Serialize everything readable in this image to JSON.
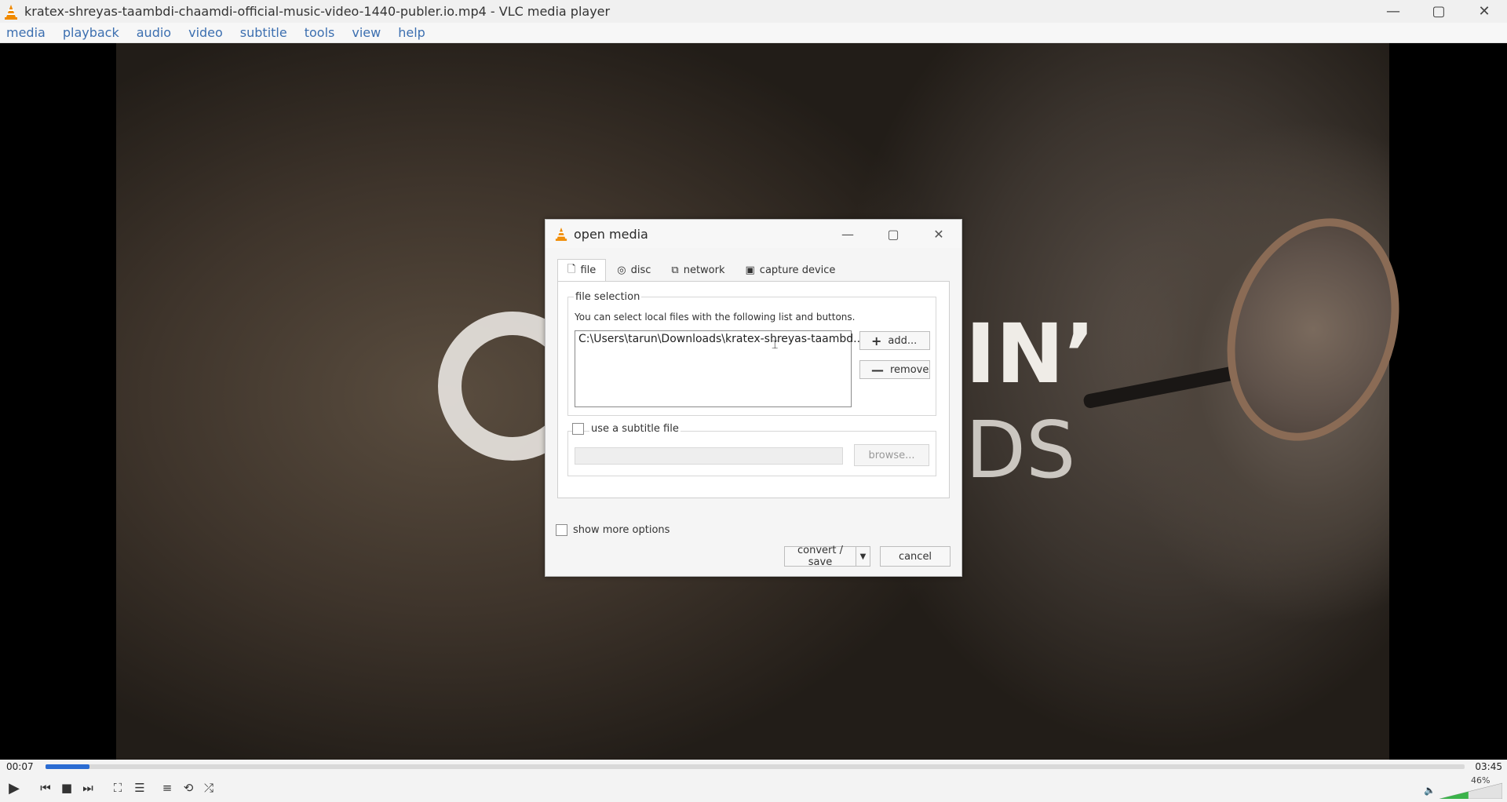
{
  "window": {
    "title": "kratex-shreyas-taambdi-chaamdi-official-music-video-1440-publer.io.mp4 - VLC media player",
    "controls": {
      "minimize": "—",
      "maximize": "▢",
      "close": "✕"
    }
  },
  "menu": [
    "media",
    "playback",
    "audio",
    "video",
    "subtitle",
    "tools",
    "view",
    "help"
  ],
  "video": {
    "overlay_text_1": "IN’",
    "overlay_text_2": "DS"
  },
  "player": {
    "current_time": "00:07",
    "total_time": "03:45",
    "progress_fraction": 0.031,
    "volume_label": "46%",
    "volume_fraction": 0.46
  },
  "dialog": {
    "title": "open media",
    "tabs": [
      {
        "label": "file",
        "icon": "file-icon"
      },
      {
        "label": "disc",
        "icon": "disc-icon"
      },
      {
        "label": "network",
        "icon": "network-icon"
      },
      {
        "label": "capture device",
        "icon": "capture-device-icon"
      }
    ],
    "file_selection_label": "file selection",
    "hint": "You can select local files with the following list and buttons.",
    "file_entry": "C:\\Users\\tarun\\Downloads\\kratex-shreyas-taambd...",
    "add_label": "add...",
    "remove_label": "remove",
    "subtitle_label": "use a subtitle file",
    "browse_label": "browse...",
    "more_options_label": "show more options",
    "convert_label": "convert / save",
    "cancel_label": "cancel"
  },
  "colors": {
    "accent": "#2b6cd2",
    "menu_text": "#3c6fb0",
    "vlc_orange": "#f08a00"
  }
}
